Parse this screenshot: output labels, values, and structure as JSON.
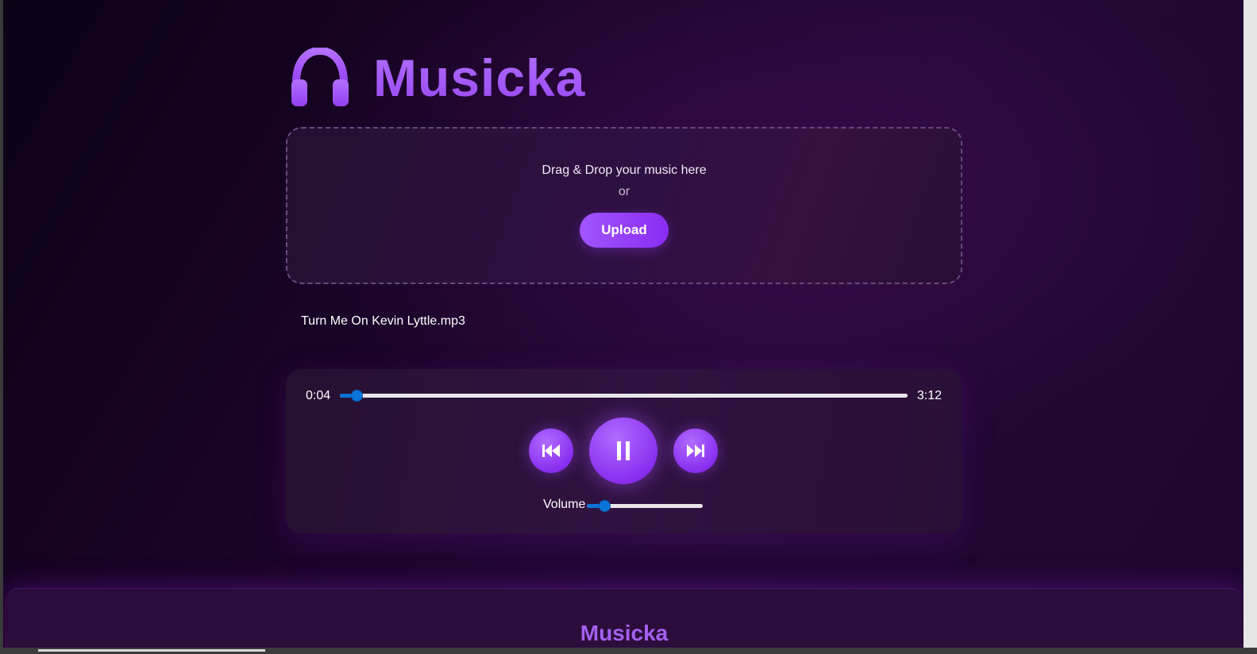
{
  "app": {
    "title": "Musicka",
    "logo_icon": "headphones-icon",
    "accent_color": "#a357f0"
  },
  "dropzone": {
    "text": "Drag & Drop your music here",
    "or": "or",
    "upload_label": "Upload"
  },
  "track": {
    "name": "Turn Me On Kevin Lyttle.mp3"
  },
  "player": {
    "current_time": "0:04",
    "duration": "3:12",
    "progress_fraction": 0.03,
    "prev_icon": "skip-previous-icon",
    "play_state_icon": "pause-icon",
    "next_icon": "skip-next-icon",
    "volume_label": "Volume",
    "volume_fraction": 0.15
  },
  "footer": {
    "title": "Musicka"
  }
}
